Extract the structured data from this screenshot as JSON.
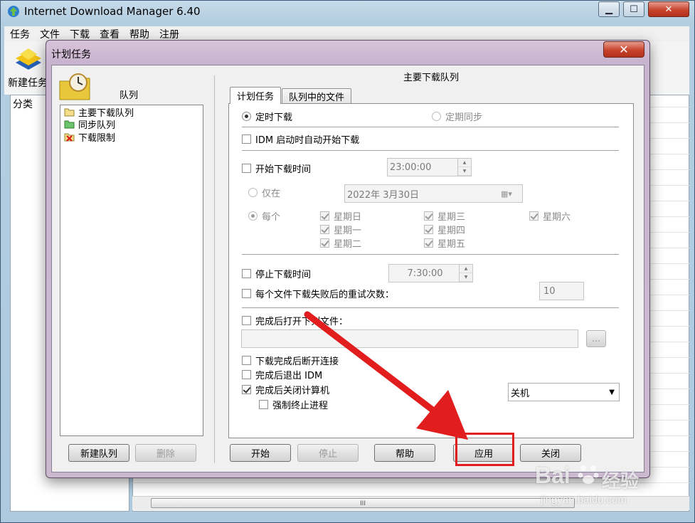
{
  "main_window": {
    "title": "Internet Download Manager 6.40",
    "menu": [
      "任务",
      "文件",
      "下载",
      "查看",
      "帮助",
      "注册"
    ],
    "toolbar_new_task": "新建任务",
    "category_header": "分类",
    "scroll_thumb": "III"
  },
  "dialog": {
    "title": "计划任务",
    "close_symbol": "✕",
    "queues": {
      "header": "队列",
      "items": [
        "主要下载队列",
        "同步队列",
        "下载限制"
      ],
      "new_button": "新建队列",
      "delete_button": "删除"
    },
    "right_header": "主要下载队列",
    "tabs": [
      "计划任务",
      "队列中的文件"
    ],
    "schedule": {
      "one_time": "定时下载",
      "periodic_sync": "定期同步",
      "start_on_idm_startup": "IDM 启动时自动开始下载",
      "start_download_time": "开始下载时间",
      "start_time_value": "23:00:00",
      "only_on": "仅在",
      "date_value": "2022年  3月30日",
      "every": "每个",
      "days": {
        "sun": "星期日",
        "mon": "星期一",
        "tue": "星期二",
        "wed": "星期三",
        "thu": "星期四",
        "fri": "星期五",
        "sat": "星期六"
      },
      "stop_download_time": "停止下载时间",
      "stop_time_value": "7:30:00",
      "retry_label": "每个文件下载失败后的重试次数：",
      "retry_value": "10",
      "open_file_after": "完成后打开下列文件：",
      "browse_button": "...",
      "hang_up": "下载完成后断开连接",
      "exit_idm": "完成后退出 IDM",
      "shutdown_computer": "完成后关闭计算机",
      "shutdown_option": "关机",
      "force_terminate": "强制终止进程"
    },
    "buttons": {
      "start": "开始",
      "stop": "停止",
      "help": "帮助",
      "apply": "应用",
      "close": "关闭"
    }
  },
  "watermark": {
    "brand_a": "Bai",
    "brand_b": "经验",
    "url": "jingyan.baidu.com"
  },
  "colors": {
    "highlight": "#e11d1d",
    "arrow": "#e11d1d",
    "dialog_frame": "#cbb9d0"
  }
}
